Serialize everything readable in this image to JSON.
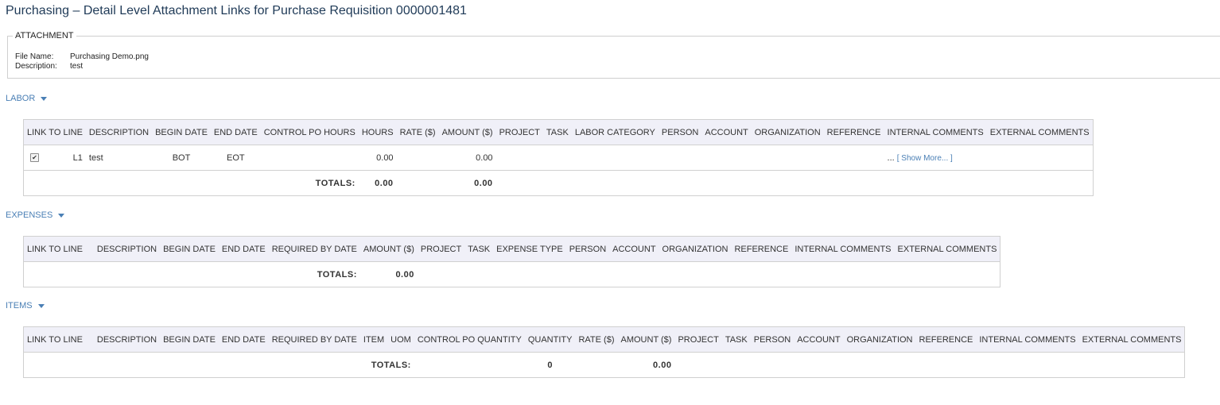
{
  "page": {
    "title": "Purchasing – Detail Level Attachment Links for Purchase Requisition 0000001481"
  },
  "attachment": {
    "legend": "ATTACHMENT",
    "file_name_label": "File Name:",
    "file_name": "Purchasing Demo.png",
    "description_label": "Description:",
    "description": "test"
  },
  "labor": {
    "title": "LABOR",
    "columns": [
      "LINK TO LINE",
      "DESCRIPTION",
      "BEGIN DATE",
      "END DATE",
      "CONTROL PO HOURS",
      "HOURS",
      "RATE ($)",
      "AMOUNT ($)",
      "PROJECT",
      "TASK",
      "LABOR CATEGORY",
      "PERSON",
      "ACCOUNT",
      "ORGANIZATION",
      "REFERENCE",
      "INTERNAL COMMENTS",
      "EXTERNAL COMMENTS"
    ],
    "row": {
      "checked": true,
      "line": "L1",
      "description": "test",
      "begin_date": "BOT",
      "end_date": "EOT",
      "hours": "0.00",
      "amount": "0.00",
      "comments_ellipsis": "...",
      "show_more": "[ Show More... ]"
    },
    "totals": {
      "label": "TOTALS:",
      "hours": "0.00",
      "amount": "0.00"
    }
  },
  "expenses": {
    "title": "EXPENSES",
    "columns": [
      "LINK TO LINE",
      "DESCRIPTION",
      "BEGIN DATE",
      "END DATE",
      "REQUIRED BY DATE",
      "AMOUNT ($)",
      "PROJECT",
      "TASK",
      "EXPENSE TYPE",
      "PERSON",
      "ACCOUNT",
      "ORGANIZATION",
      "REFERENCE",
      "INTERNAL COMMENTS",
      "EXTERNAL COMMENTS"
    ],
    "totals": {
      "label": "TOTALS:",
      "amount": "0.00"
    }
  },
  "items": {
    "title": "ITEMS",
    "columns": [
      "LINK TO LINE",
      "DESCRIPTION",
      "BEGIN DATE",
      "END DATE",
      "REQUIRED BY DATE",
      "ITEM",
      "UOM",
      "CONTROL PO QUANTITY",
      "QUANTITY",
      "RATE ($)",
      "AMOUNT ($)",
      "PROJECT",
      "TASK",
      "PERSON",
      "ACCOUNT",
      "ORGANIZATION",
      "REFERENCE",
      "INTERNAL COMMENTS",
      "EXTERNAL COMMENTS"
    ],
    "totals": {
      "label": "TOTALS:",
      "quantity": "0",
      "amount": "0.00"
    }
  },
  "colors": {
    "title": "#1f3a57",
    "link": "#4a7fb5",
    "header_bg": "#f0f0f8",
    "border": "#d0d0d0"
  },
  "icons": {
    "section_toggle": "caret-down-icon",
    "checkbox": "checkbox-checked-icon"
  }
}
